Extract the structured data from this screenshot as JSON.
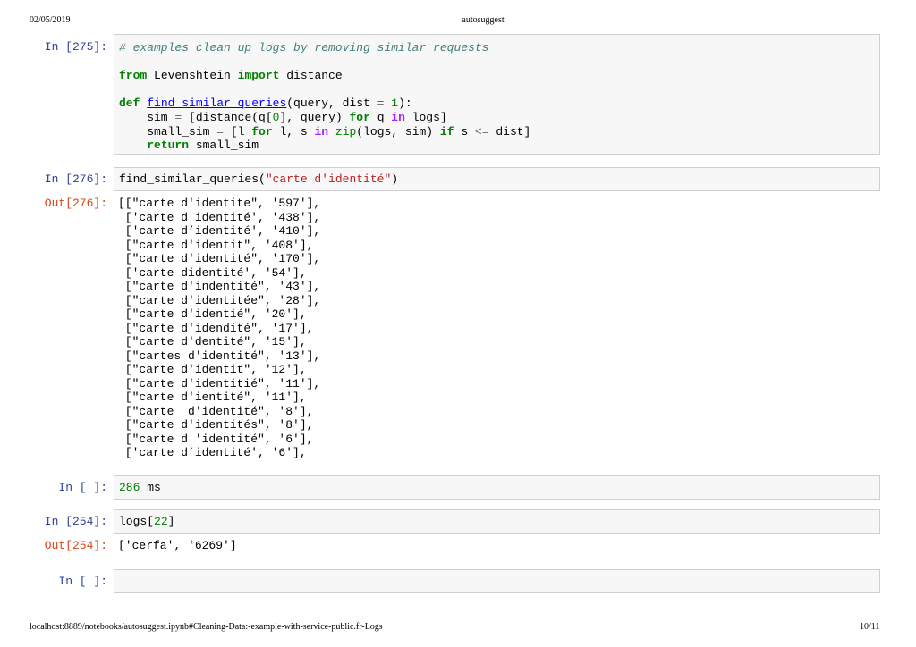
{
  "header": {
    "date": "02/05/2019",
    "title": "autosuggest"
  },
  "footer": {
    "url": "localhost:8889/notebooks/autosuggest.ipynb#Cleaning-Data:-example-with-service-public.fr-Logs",
    "page": "10/11"
  },
  "cells": {
    "c275": {
      "prompt": "In [275]:",
      "comment": "# examples clean up logs by removing similar requests",
      "line_import": [
        "from",
        " Levenshtein ",
        "import",
        " distance"
      ],
      "def_kw": "def",
      "def_name": "find_similar_queries",
      "def_args": "(query, dist ",
      "def_eq": "=",
      "def_one": "1",
      "def_end": "):",
      "l_sim_a": "    sim ",
      "l_sim_eq": "=",
      "l_sim_b": " [distance(q[",
      "l_sim_zero": "0",
      "l_sim_c": "], query) ",
      "l_sim_for": "for",
      "l_sim_d": " q ",
      "l_sim_in": "in",
      "l_sim_e": " logs]",
      "l_small_a": "    small_sim ",
      "l_small_eq": "=",
      "l_small_b": " [l ",
      "l_small_for": "for",
      "l_small_c": " l, s ",
      "l_small_in": "in",
      "l_small_d": " ",
      "l_small_zip": "zip",
      "l_small_e": "(logs, sim) ",
      "l_small_if": "if",
      "l_small_f": " s ",
      "l_small_le": "<=",
      "l_small_g": " dist]",
      "l_ret_sp": "    ",
      "l_ret_kw": "return",
      "l_ret_v": " small_sim"
    },
    "c276": {
      "prompt": "In [276]:",
      "call": "find_similar_queries(",
      "arg": "\"carte d'identité\"",
      "close": ")",
      "out_prompt": "Out[276]:",
      "output_lines": [
        "[[\"carte d'identite\", '597'],",
        " ['carte d identité', '438'],",
        " ['carte d’identité', '410'],",
        " [\"carte d'identit\", '408'],",
        " [\"carte d'identité\", '170'],",
        " ['carte didentité', '54'],",
        " [\"carte d'indentité\", '43'],",
        " [\"carte d'identitée\", '28'],",
        " [\"carte d'identié\", '20'],",
        " [\"carte d'idendité\", '17'],",
        " [\"carte d'dentité\", '15'],",
        " [\"cartes d'identité\", '13'],",
        " [\"carte d'identit\", '12'],",
        " [\"carte d'identitié\", '11'],",
        " [\"carte d'ientité\", '11'],",
        " [\"carte  d'identité\", '8'],",
        " [\"carte d'identités\", '8'],",
        " [\"carte d 'identité\", '6'],",
        " ['carte d´identité', '6'],"
      ]
    },
    "cblank1": {
      "prompt": "In [ ]:",
      "num": "286",
      "unit": " ms"
    },
    "c254": {
      "prompt": "In [254]:",
      "var": "logs[",
      "idx": "22",
      "close": "]",
      "out_prompt": "Out[254]:",
      "output": "['cerfa', '6269']"
    },
    "cblank2": {
      "prompt": "In [ ]:"
    }
  }
}
